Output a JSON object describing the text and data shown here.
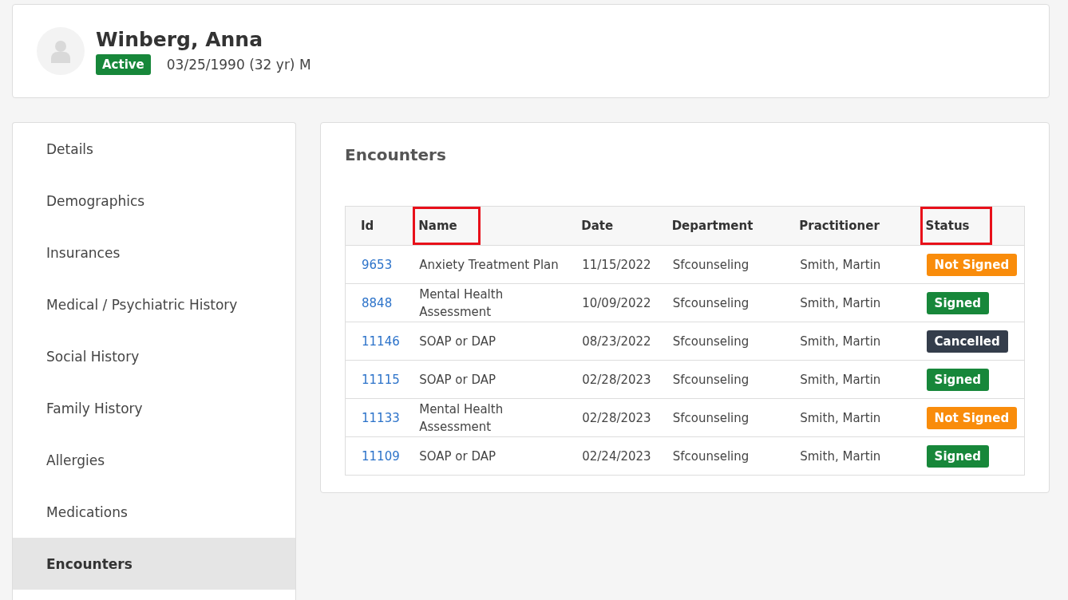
{
  "patient": {
    "name": "Winberg, Anna",
    "status": "Active",
    "details": "03/25/1990 (32 yr) M"
  },
  "sidebar": {
    "items": [
      {
        "label": "Details",
        "selected": false
      },
      {
        "label": "Demographics",
        "selected": false
      },
      {
        "label": "Insurances",
        "selected": false
      },
      {
        "label": "Medical / Psychiatric History",
        "selected": false
      },
      {
        "label": "Social History",
        "selected": false
      },
      {
        "label": "Family History",
        "selected": false
      },
      {
        "label": "Allergies",
        "selected": false
      },
      {
        "label": "Medications",
        "selected": false
      },
      {
        "label": "Encounters",
        "selected": true
      }
    ]
  },
  "encounters": {
    "title": "Encounters",
    "columns": [
      {
        "label": "Id",
        "highlighted": false
      },
      {
        "label": "Name",
        "highlighted": true
      },
      {
        "label": "Date",
        "highlighted": false
      },
      {
        "label": "Department",
        "highlighted": false
      },
      {
        "label": "Practitioner",
        "highlighted": false
      },
      {
        "label": "Status",
        "highlighted": true
      }
    ],
    "rows": [
      {
        "id": "9653",
        "name": "Anxiety Treatment Plan",
        "date": "11/15/2022",
        "department": "Sfcounseling",
        "practitioner": "Smith, Martin",
        "status": "Not Signed",
        "kind": "pending"
      },
      {
        "id": "8848",
        "name": "Mental Health Assessment",
        "date": "10/09/2022",
        "department": "Sfcounseling",
        "practitioner": "Smith, Martin",
        "status": "Signed",
        "kind": "signed"
      },
      {
        "id": "11146",
        "name": "SOAP or DAP",
        "date": "08/23/2022",
        "department": "Sfcounseling",
        "practitioner": "Smith, Martin",
        "status": "Cancelled",
        "kind": "cancelled"
      },
      {
        "id": "11115",
        "name": "SOAP or DAP",
        "date": "02/28/2023",
        "department": "Sfcounseling",
        "practitioner": "Smith, Martin",
        "status": "Signed",
        "kind": "signed"
      },
      {
        "id": "11133",
        "name": "Mental Health Assessment",
        "date": "02/28/2023",
        "department": "Sfcounseling",
        "practitioner": "Smith, Martin",
        "status": "Not Signed",
        "kind": "pending"
      },
      {
        "id": "11109",
        "name": "SOAP or DAP",
        "date": "02/24/2023",
        "department": "Sfcounseling",
        "practitioner": "Smith, Martin",
        "status": "Signed",
        "kind": "signed"
      }
    ]
  }
}
